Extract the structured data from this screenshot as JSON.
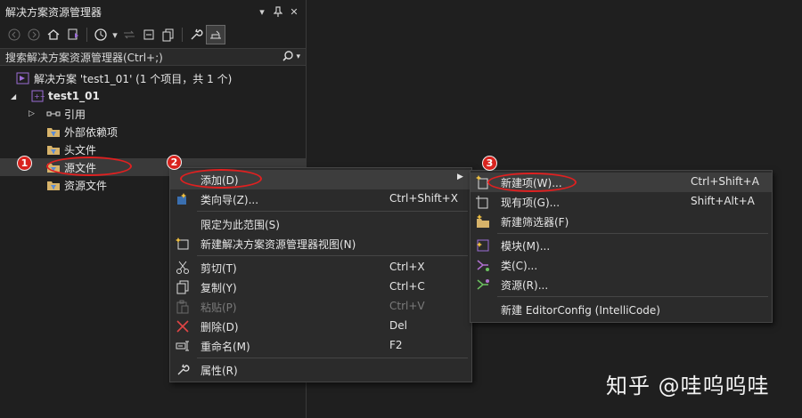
{
  "panel": {
    "title": "解决方案资源管理器",
    "title_icons": [
      "dropdown-icon",
      "pin-icon",
      "close-icon"
    ],
    "search": {
      "placeholder": "搜索解决方案资源管理器(Ctrl+;)"
    }
  },
  "tree": {
    "solution_label": "解决方案 'test1_01' (1 个项目，共 1 个)",
    "project_label": "test1_01",
    "items": [
      {
        "label": "引用",
        "icon": "references-icon"
      },
      {
        "label": "外部依赖项",
        "icon": "filter-folder-icon"
      },
      {
        "label": "头文件",
        "icon": "filter-folder-icon"
      },
      {
        "label": "源文件",
        "icon": "filter-folder-icon"
      },
      {
        "label": "资源文件",
        "icon": "filter-folder-icon"
      }
    ]
  },
  "context_menu": {
    "items": [
      {
        "label": "添加(D)",
        "shortcut": "",
        "icon": ""
      },
      {
        "label": "类向导(Z)...",
        "shortcut": "Ctrl+Shift+X",
        "icon": "class-wizard-icon"
      },
      {
        "label": "限定为此范围(S)",
        "shortcut": "",
        "icon": ""
      },
      {
        "label": "新建解决方案资源管理器视图(N)",
        "shortcut": "",
        "icon": "new-view-icon"
      },
      {
        "label": "剪切(T)",
        "shortcut": "Ctrl+X",
        "icon": "scissors-icon"
      },
      {
        "label": "复制(Y)",
        "shortcut": "Ctrl+C",
        "icon": "copy-icon"
      },
      {
        "label": "粘贴(P)",
        "shortcut": "Ctrl+V",
        "icon": "paste-icon"
      },
      {
        "label": "删除(D)",
        "shortcut": "Del",
        "icon": "delete-icon"
      },
      {
        "label": "重命名(M)",
        "shortcut": "F2",
        "icon": "rename-icon"
      },
      {
        "label": "属性(R)",
        "shortcut": "",
        "icon": "wrench-icon"
      }
    ]
  },
  "submenu": {
    "items": [
      {
        "label": "新建项(W)...",
        "shortcut": "Ctrl+Shift+A",
        "icon": "new-item-icon"
      },
      {
        "label": "现有项(G)...",
        "shortcut": "Shift+Alt+A",
        "icon": "existing-item-icon"
      },
      {
        "label": "新建筛选器(F)",
        "shortcut": "",
        "icon": "new-filter-icon"
      },
      {
        "label": "模块(M)...",
        "shortcut": "",
        "icon": "module-icon"
      },
      {
        "label": "类(C)...",
        "shortcut": "",
        "icon": "class-icon"
      },
      {
        "label": "资源(R)...",
        "shortcut": "",
        "icon": "resource-icon"
      },
      {
        "label": "新建 EditorConfig (IntelliCode)",
        "shortcut": "",
        "icon": ""
      }
    ]
  },
  "annotations": [
    "1",
    "2",
    "3"
  ],
  "watermark": "知乎 @哇呜呜哇",
  "colors": {
    "background": "#1f1f1f",
    "menu": "#2b2b2b",
    "highlight": "#3d3d3d",
    "annotation_red": "#e02020"
  }
}
